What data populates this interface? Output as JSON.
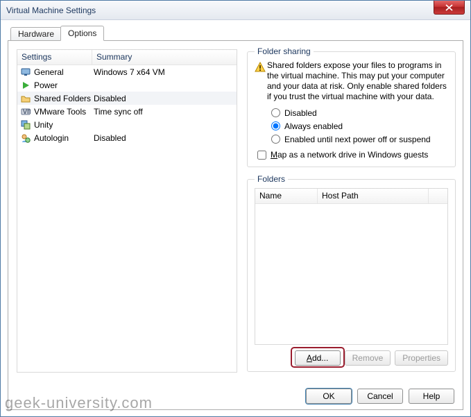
{
  "title": "Virtual Machine Settings",
  "tabs": {
    "hardware": "Hardware",
    "options": "Options"
  },
  "leftHeader": {
    "settings": "Settings",
    "summary": "Summary"
  },
  "leftRows": [
    {
      "icon": "monitor-icon",
      "name": "General",
      "summary": "Windows 7 x64 VM"
    },
    {
      "icon": "play-icon",
      "name": "Power",
      "summary": ""
    },
    {
      "icon": "folder-share-icon",
      "name": "Shared Folders",
      "summary": "Disabled"
    },
    {
      "icon": "vmware-tools-icon",
      "name": "VMware Tools",
      "summary": "Time sync off"
    },
    {
      "icon": "unity-icon",
      "name": "Unity",
      "summary": ""
    },
    {
      "icon": "autologin-icon",
      "name": "Autologin",
      "summary": "Disabled"
    }
  ],
  "folderSharing": {
    "legend": "Folder sharing",
    "warning": "Shared folders expose your files to programs in the virtual machine. This may put your computer and your data at risk. Only enable shared folders if you trust the virtual machine with your data.",
    "radios": {
      "disabled": "Disabled",
      "always": "Always enabled",
      "until": "Enabled until next power off or suspend"
    },
    "mapDrivePrefix": "M",
    "mapDriveRest": "ap as a network drive in Windows guests"
  },
  "folders": {
    "legend": "Folders",
    "headers": {
      "name": "Name",
      "hostPath": "Host Path"
    },
    "buttons": {
      "addPre": "A",
      "addRest": "dd...",
      "remove": "Remove",
      "properties": "Properties"
    }
  },
  "bottom": {
    "ok": "OK",
    "cancel": "Cancel",
    "help": "Help"
  },
  "watermark": "geek-university.com"
}
